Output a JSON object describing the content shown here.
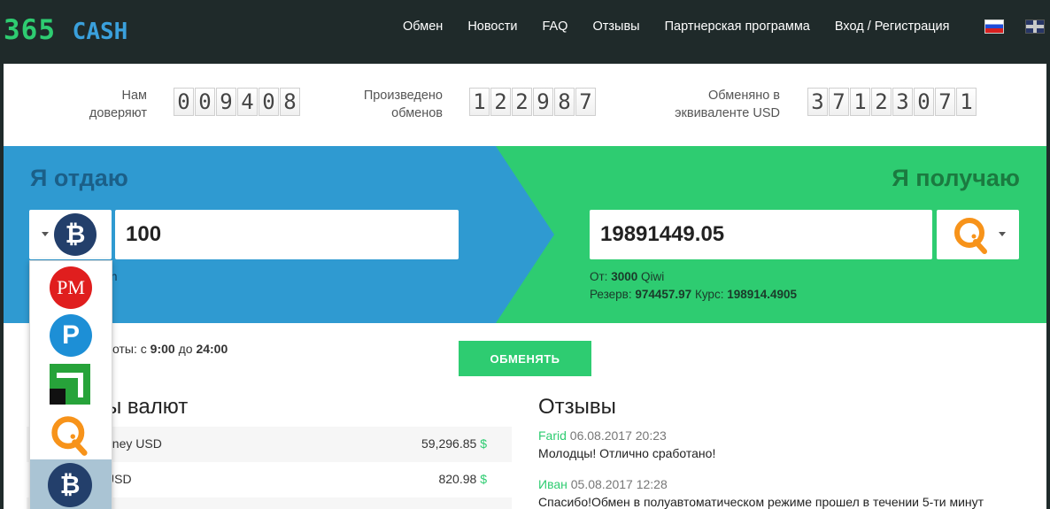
{
  "header": {
    "logo_number": "365",
    "logo_word": "CASH",
    "nav": [
      "Обмен",
      "Новости",
      "FAQ",
      "Отзывы",
      "Партнерская программа",
      "Вход / Регистрация"
    ]
  },
  "stats": [
    {
      "label_line1": "Нам",
      "label_line2": "доверяют",
      "digits": "009408"
    },
    {
      "label_line1": "Произведено",
      "label_line2": "обменов",
      "digits": "122987"
    },
    {
      "label_line1": "Обменяно в",
      "label_line2": "эквиваленте USD",
      "digits": "37123071"
    }
  ],
  "exchange": {
    "give_title": "Я отдаю",
    "get_title": "Я получаю",
    "give_amount": "100",
    "get_amount": "19891449.05",
    "give_currency_icon": "bitcoin-icon",
    "get_currency_icon": "qiwi-icon",
    "give_hint_fragment": "n",
    "min_label": "От:",
    "min_value": "3000",
    "min_currency": "Qiwi",
    "reserve_label": "Резерв:",
    "reserve_value": "974457.97",
    "rate_label": "Курс:",
    "rate_value": "198914.4905",
    "button_label": "ОБМЕНЯТЬ"
  },
  "hours": {
    "prefix": "боты:",
    "from_word": "с",
    "from_time": "9:00",
    "to_word": "до",
    "to_time": "24:00"
  },
  "rates": {
    "title_fragment": "ы валют",
    "rows": [
      {
        "name": "oney USD",
        "value": "59,296.85",
        "unit": "$"
      },
      {
        "name": "USD",
        "value": "820.98",
        "unit": "$"
      }
    ]
  },
  "reviews": {
    "title": "Отзывы",
    "items": [
      {
        "author": "Farid",
        "date": "06.08.2017 20:23",
        "text": "Молодцы! Отлично сработано!"
      },
      {
        "author": "Иван",
        "date": "05.08.2017 12:28",
        "text": "Спасибо!Обмен в полуавтоматическом режиме прошел в течении 5-ти минут"
      }
    ]
  },
  "dropdown_items": [
    {
      "icon": "perfect-money-icon",
      "label": "PM"
    },
    {
      "icon": "payeer-icon",
      "label": "P"
    },
    {
      "icon": "privatbank-icon"
    },
    {
      "icon": "qiwi-icon"
    },
    {
      "icon": "bitcoin-icon",
      "selected": true
    }
  ],
  "colors": {
    "green": "#2ecc71",
    "blue": "#2f9ad1",
    "dark": "#1f2a2a"
  }
}
